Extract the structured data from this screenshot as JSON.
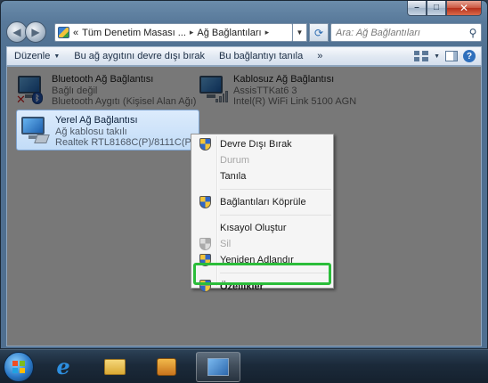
{
  "window": {
    "caption": {
      "minimize": "–",
      "maximize": "□",
      "close": "✕"
    }
  },
  "nav": {
    "back": "◀",
    "forward": "▶",
    "breadcrumb_prefix": "«",
    "breadcrumb": [
      "Tüm Denetim Masası ...",
      "Ağ Bağlantıları"
    ],
    "breadcrumb_sep": "▸",
    "search_placeholder": "Ara: Ağ Bağlantıları"
  },
  "commandbar": {
    "organize": "Düzenle",
    "disable_device": "Bu ağ aygıtını devre dışı bırak",
    "diagnose": "Bu bağlantıyı tanıla",
    "more": "»"
  },
  "connections": [
    {
      "name": "Bluetooth Ağ Bağlantısı",
      "status": "Bağlı değil",
      "device": "Bluetooth Aygıtı (Kişisel Alan Ağı)"
    },
    {
      "name": "Kablosuz Ağ Bağlantısı",
      "status": "AssisTTKat6  3",
      "device": "Intel(R) WiFi Link 5100 AGN"
    },
    {
      "name": "Yerel Ağ Bağlantısı",
      "status": "Ağ kablosu takılı",
      "device": "Realtek RTL8168C(P)/8111C(P) Ail..."
    }
  ],
  "context_menu": {
    "disable": "Devre Dışı Bırak",
    "status": "Durum",
    "diagnose": "Tanıla",
    "bridge": "Bağlantıları Köprüle",
    "shortcut": "Kısayol Oluştur",
    "delete": "Sil",
    "rename": "Yeniden Adlandır",
    "properties": "Özellikler"
  },
  "colors": {
    "highlight_border": "#2bbd3a",
    "selection_fill": "#c2dcf7",
    "disabled_text": "#a7a7a7"
  }
}
